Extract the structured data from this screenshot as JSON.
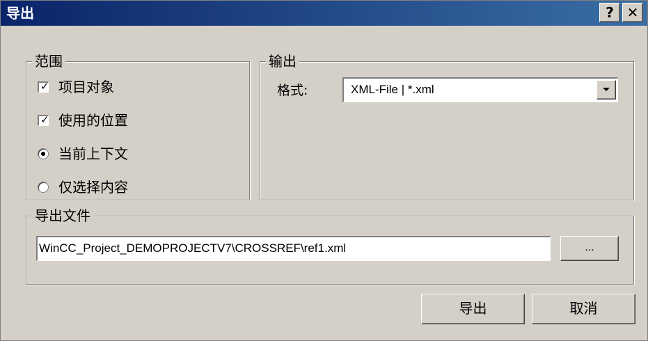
{
  "window": {
    "title": "导出",
    "help_label": "?",
    "close_label": "✕"
  },
  "range_group": {
    "label": "范围",
    "options": [
      {
        "label": "项目对象",
        "type": "checkbox",
        "checked": true
      },
      {
        "label": "使用的位置",
        "type": "checkbox",
        "checked": true
      },
      {
        "label": "当前上下文",
        "type": "radio",
        "checked": true
      },
      {
        "label": "仅选择内容",
        "type": "radio",
        "checked": false
      }
    ]
  },
  "output_group": {
    "label": "输出",
    "format_label": "格式:",
    "format_value": "XML-File | *.xml"
  },
  "export_file_group": {
    "label": "导出文件",
    "path_value": "WinCC_Project_DEMOPROJECTV7\\CROSSREF\\ref1.xml",
    "browse_label": "..."
  },
  "buttons": {
    "export_label": "导出",
    "cancel_label": "取消"
  },
  "colors": {
    "title_start": "#0a246a",
    "title_end": "#3a6ea5",
    "face": "#d4d0c8"
  }
}
